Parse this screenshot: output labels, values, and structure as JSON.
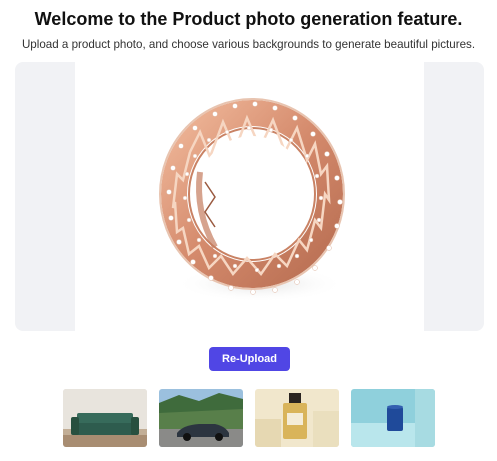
{
  "header": {
    "title": "Welcome to the Product photo generation feature.",
    "subtitle": "Upload a product photo, and choose various backgrounds to generate beautiful pictures."
  },
  "preview": {
    "image": "rose-gold-diamond-ring-product-photo"
  },
  "actions": {
    "reupload_label": "Re-Upload"
  },
  "backgrounds": [
    {
      "name": "green-sofa-living-room"
    },
    {
      "name": "car-on-mountain-road"
    },
    {
      "name": "perfume-bottle-on-cream-blocks"
    },
    {
      "name": "blue-cup-on-blue-podium"
    }
  ],
  "colors": {
    "accent": "#5046e5",
    "preview_bg": "#f1f2f5",
    "ring": "#d8957a"
  }
}
